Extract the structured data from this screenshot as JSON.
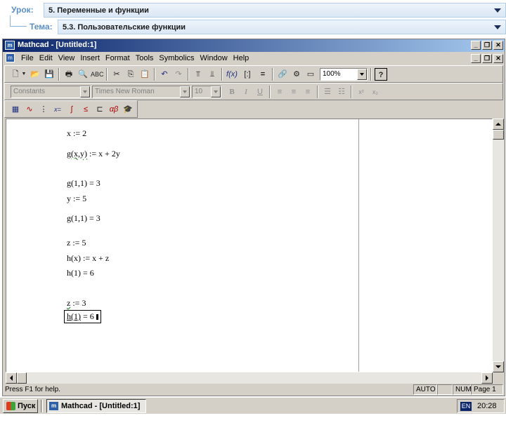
{
  "lesson": {
    "label": "Урок:",
    "value": "5. Переменные и функции",
    "topic_label": "Тема:",
    "topic_value": "5.3. Пользовательские функции"
  },
  "window": {
    "title": "Mathcad - [Untitled:1]",
    "min": "_",
    "restore": "❐",
    "close": "✕"
  },
  "menu": [
    "File",
    "Edit",
    "View",
    "Insert",
    "Format",
    "Tools",
    "Symbolics",
    "Window",
    "Help"
  ],
  "format_toolbar": {
    "style": "Constants",
    "font": "Times New Roman",
    "size": "10"
  },
  "toolbar": {
    "zoom": "100%"
  },
  "worksheet": [
    {
      "lhs": "x",
      "op": ":=",
      "rhs": "2"
    },
    {
      "lhs": "g(x,y)",
      "op": ":=",
      "rhs": "x + 2y"
    },
    {
      "lhs": "g(1,1)",
      "op": "=",
      "rhs": "3"
    },
    {
      "lhs": "y",
      "op": ":=",
      "rhs": "5"
    },
    {
      "lhs": "g(1,1)",
      "op": "=",
      "rhs": "3"
    },
    {
      "lhs": "z",
      "op": ":=",
      "rhs": "5"
    },
    {
      "lhs": "h(x)",
      "op": ":=",
      "rhs": "x + z"
    },
    {
      "lhs": "h(1)",
      "op": "=",
      "rhs": "6"
    },
    {
      "lhs": "z",
      "op": ":=",
      "rhs": "3"
    },
    {
      "lhs": "h(1)",
      "op": "=",
      "rhs": "6"
    }
  ],
  "status": {
    "help": "Press F1 for help.",
    "auto": "AUTO",
    "num": "NUM",
    "page": "Page 1"
  },
  "taskbar": {
    "start": "Пуск",
    "task": "Mathcad - [Untitled:1]",
    "lang": "EN",
    "clock": "20:28"
  }
}
